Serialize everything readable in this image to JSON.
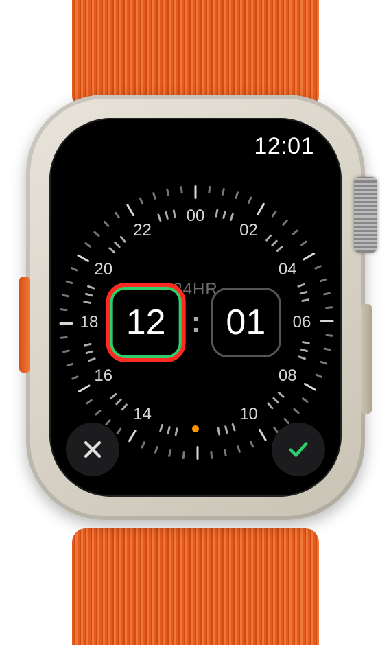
{
  "status": {
    "time": "12:01"
  },
  "dial": {
    "mode_label": "24HR",
    "hour_numbers": [
      "00",
      "02",
      "04",
      "06",
      "08",
      "10",
      "14",
      "16",
      "18",
      "20",
      "22"
    ],
    "current_marker": "12"
  },
  "picker": {
    "hours": "12",
    "minutes": "01",
    "separator": ":",
    "active_field": "hours"
  },
  "buttons": {
    "cancel": "Cancel",
    "confirm": "Confirm"
  },
  "colors": {
    "accent_orange": "#ff9500",
    "confirm_green": "#2fce6a",
    "highlight_red": "#ff2a22"
  }
}
